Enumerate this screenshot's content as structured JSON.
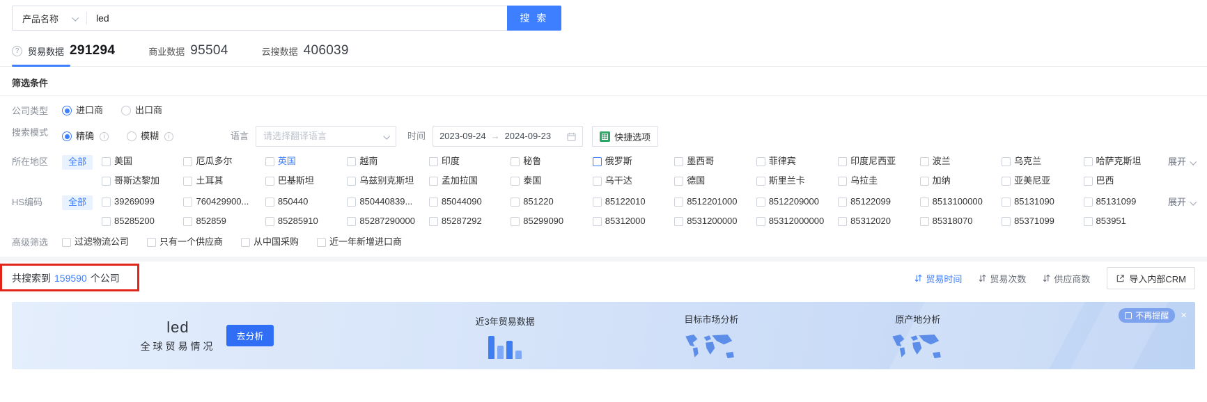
{
  "colors": {
    "accent": "#3d7fff",
    "annotation_red": "#e2231a",
    "excel_green": "#28a864",
    "banner_bg_start": "#e4eefc",
    "banner_bg_end": "#bdd3f4"
  },
  "icons": {
    "help": "?",
    "info": "i",
    "arrow_right": "→",
    "close": "×"
  },
  "search": {
    "category": "产品名称",
    "query": "led",
    "button": "搜 索"
  },
  "tabs": [
    {
      "label": "贸易数据",
      "count": "291294",
      "active": true
    },
    {
      "label": "商业数据",
      "count": "95504",
      "active": false
    },
    {
      "label": "云搜数据",
      "count": "406039",
      "active": false
    }
  ],
  "filters": {
    "section_title": "筛选条件",
    "company_type": {
      "label": "公司类型",
      "options": [
        {
          "label": "进口商",
          "selected": true
        },
        {
          "label": "出口商",
          "selected": false
        }
      ]
    },
    "search_mode": {
      "label": "搜索模式",
      "options": [
        {
          "label": "精确",
          "selected": true
        },
        {
          "label": "模糊",
          "selected": false
        }
      ],
      "language_label": "语言",
      "language_placeholder": "请选择翻译语言",
      "time_label": "时间",
      "date_start": "2023-09-24",
      "date_end": "2024-09-23",
      "quick_option_label": "快捷选项"
    },
    "region": {
      "label": "所在地区",
      "all_label": "全部",
      "expand_label": "展开",
      "items": [
        {
          "label": "美国"
        },
        {
          "label": "厄瓜多尔"
        },
        {
          "label": "英国",
          "mod": "hl-text"
        },
        {
          "label": "越南"
        },
        {
          "label": "印度"
        },
        {
          "label": "秘鲁"
        },
        {
          "label": "俄罗斯",
          "mod": "hl-box"
        },
        {
          "label": "墨西哥"
        },
        {
          "label": "菲律宾"
        },
        {
          "label": "印度尼西亚"
        },
        {
          "label": "波兰"
        },
        {
          "label": "乌克兰"
        },
        {
          "label": "哈萨克斯坦"
        },
        {
          "label": "哥斯达黎加"
        },
        {
          "label": "土耳其"
        },
        {
          "label": "巴基斯坦"
        },
        {
          "label": "乌兹别克斯坦"
        },
        {
          "label": "孟加拉国"
        },
        {
          "label": "泰国"
        },
        {
          "label": "乌干达"
        },
        {
          "label": "德国"
        },
        {
          "label": "斯里兰卡"
        },
        {
          "label": "乌拉圭"
        },
        {
          "label": "加纳"
        },
        {
          "label": "亚美尼亚"
        },
        {
          "label": "巴西"
        }
      ]
    },
    "hs_code": {
      "label": "HS编码",
      "all_label": "全部",
      "expand_label": "展开",
      "items": [
        "39269099",
        "760429900...",
        "850440",
        "850440839...",
        "85044090",
        "851220",
        "85122010",
        "8512201000",
        "8512209000",
        "85122099",
        "8513100000",
        "85131090",
        "85131099",
        "85285200",
        "852859",
        "85285910",
        "85287290000",
        "85287292",
        "85299090",
        "85312000",
        "8531200000",
        "85312000000",
        "85312020",
        "85318070",
        "85371099",
        "853951"
      ]
    },
    "advanced": {
      "label": "高级筛选",
      "items": [
        "过滤物流公司",
        "只有一个供应商",
        "从中国采购",
        "近一年新增进口商"
      ]
    }
  },
  "results": {
    "summary_prefix": "共搜索到",
    "count": "159590",
    "summary_suffix": "个公司",
    "sorts": [
      {
        "label": "贸易时间",
        "mod": "active"
      },
      {
        "label": "贸易次数"
      },
      {
        "label": "供应商数"
      }
    ],
    "crm_button": "导入内部CRM"
  },
  "banner": {
    "keyword": "led",
    "subtitle": "全球贸易情况",
    "analyze_button": "去分析",
    "cards": [
      {
        "title": "近3年贸易数据",
        "icon": "bar-chart-icon"
      },
      {
        "title": "目标市场分析",
        "icon": "world-map-icon"
      },
      {
        "title": "原产地分析",
        "icon": "world-map-icon"
      }
    ],
    "dismiss_label": "不再提醒"
  }
}
